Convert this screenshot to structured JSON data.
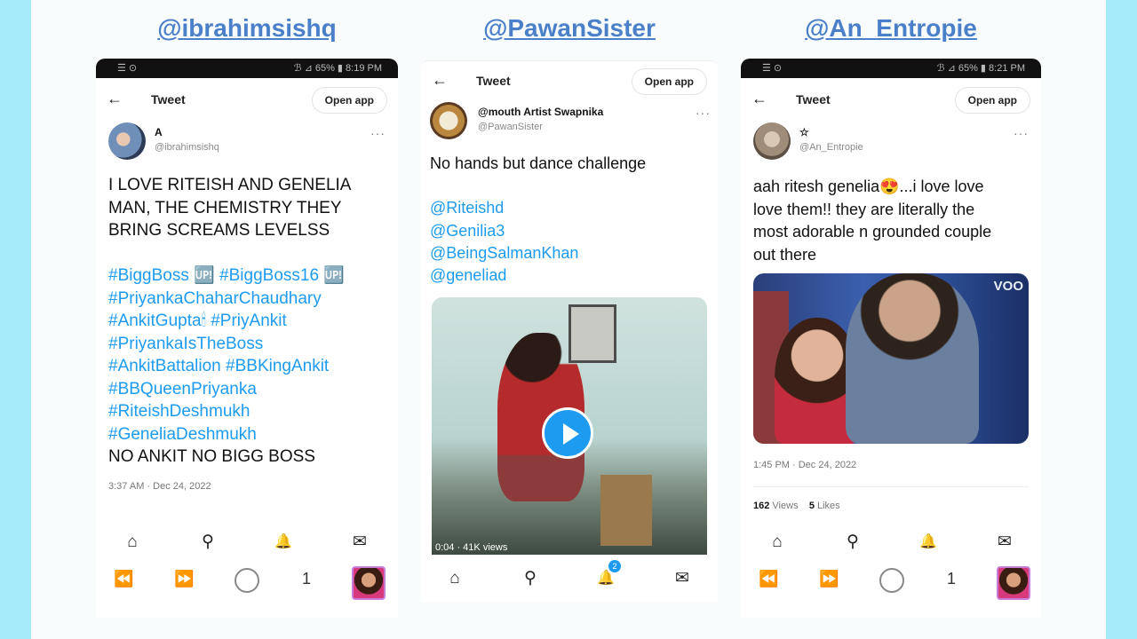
{
  "columns": [
    {
      "handle": "@ibrahimsishq",
      "status_left": "☰ ⊙",
      "status_right": "ℬ ⊿ 65% ▮ 8:19 PM",
      "back": "←",
      "title": "Tweet",
      "open_app": "Open app",
      "user_name": "A",
      "user_handle": "@ibrahimsishq",
      "more": "···",
      "lines": [
        "I LOVE RITEISH AND GENELIA",
        "MAN, THE CHEMISTRY THEY",
        "BRING SCREAMS LEVELSS",
        "",
        " #BiggBoss 🆙 #BiggBoss16 🆙",
        "#PriyankaChaharChaudhary",
        "#AnkitGupta🕯 #PriyAnkit",
        "#PriyankaIsTheBoss",
        "#AnkitBattalion #BBKingAnkit",
        "#BBQueenPriyanka",
        "#RiteishDeshmukh",
        "#GeneliaDeshmukh",
        "NO ANKIT NO BIGG BOSS"
      ],
      "timestamp": "3:37 AM · Dec 24, 2022",
      "nav": [
        "⌂",
        "⚲",
        "🔔",
        "✉"
      ],
      "controls": {
        "prev": "⏪",
        "next": "⏩",
        "count": "1"
      }
    },
    {
      "handle": "@PawanSister",
      "back": "←",
      "title": "Tweet",
      "open_app": "Open app",
      "user_name": "@mouth Artist Swapnika",
      "user_handle": "@PawanSister",
      "more": "···",
      "lines": [
        "No hands but dance challenge",
        "",
        "@Riteishd",
        "@Genilia3",
        "@BeingSalmanKhan",
        "@geneliad"
      ],
      "video_time": "0:04 · 41K views",
      "nav": [
        "⌂",
        "⚲",
        "🔔",
        "✉"
      ],
      "notif_count": "2"
    },
    {
      "handle": "@An_Entropie",
      "status_left": "☰ ⊙",
      "status_right": "ℬ ⊿ 65% ▮ 8:21 PM",
      "back": "←",
      "title": "Tweet",
      "open_app": "Open app",
      "user_name": "☆",
      "user_handle": "@An_Entropie",
      "more": "···",
      "lines": [
        "aah ritesh genelia😍...i love love",
        "love them!! they are literally the",
        "most adorable n grounded couple",
        "out there"
      ],
      "image_tag": "VOO",
      "timestamp": "1:45 PM · Dec 24, 2022",
      "views": "162",
      "views_label": "Views",
      "likes": "5",
      "likes_label": "Likes",
      "nav": [
        "⌂",
        "⚲",
        "🔔",
        "✉"
      ],
      "controls": {
        "prev": "⏪",
        "next": "⏩",
        "count": "1"
      }
    }
  ]
}
